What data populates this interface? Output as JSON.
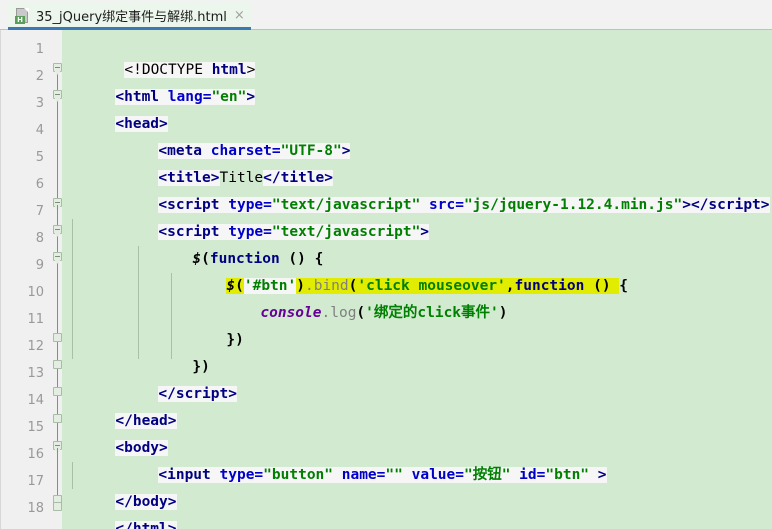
{
  "window": {
    "app": "IntelliJ IDEA HTML Editor"
  },
  "tab": {
    "title": "35_jQuery绑定事件与解绑.html",
    "icon": "html-file-icon",
    "badge": "H",
    "close": "×"
  },
  "editor": {
    "background_color": "#d2ead0",
    "text_background_color": "#f6f6f6",
    "highlight_color": "#e2ec00",
    "gutter_color": "#f0f0f0",
    "line_count": 18,
    "line_numbers": [
      "1",
      "2",
      "3",
      "4",
      "5",
      "6",
      "7",
      "8",
      "9",
      "10",
      "11",
      "12",
      "13",
      "14",
      "15",
      "16",
      "17",
      "18"
    ],
    "lines": [
      {
        "n": "1",
        "text": "<!DOCTYPE html>"
      },
      {
        "n": "2",
        "text": "<html lang=\"en\">"
      },
      {
        "n": "3",
        "text": "<head>"
      },
      {
        "n": "4",
        "text": "    <meta charset=\"UTF-8\">"
      },
      {
        "n": "5",
        "text": "    <title>Title</title>"
      },
      {
        "n": "6",
        "text": "    <script type=\"text/javascript\" src=\"js/jquery-1.12.4.min.js\"></script>"
      },
      {
        "n": "7",
        "text": "    <script type=\"text/javascript\">"
      },
      {
        "n": "8",
        "text": "        $(function () {"
      },
      {
        "n": "9",
        "text": "            $('#btn').bind('click mouseover',function () {"
      },
      {
        "n": "10",
        "text": "                console.log('绑定的click事件')"
      },
      {
        "n": "11",
        "text": "            })"
      },
      {
        "n": "12",
        "text": "        })"
      },
      {
        "n": "13",
        "text": "    </script>"
      },
      {
        "n": "14",
        "text": "</head>"
      },
      {
        "n": "15",
        "text": "<body>"
      },
      {
        "n": "16",
        "text": "    <input type=\"button\" name=\"\" value=\"按钮\" id=\"btn\" >"
      },
      {
        "n": "17",
        "text": "</body>"
      },
      {
        "n": "18",
        "text": "</html>"
      }
    ],
    "tokens": {
      "doctype": "<!DOCTYPE ",
      "doctype_name": "html",
      "gt": ">",
      "lt_html": "<html",
      "lang_attr": " lang=",
      "lang_val": "\"en\"",
      "lt_head": "<head",
      "lt_meta": "<meta",
      "charset_attr": " charset=",
      "charset_val": "\"UTF-8\"",
      "lt_title": "<title",
      "title_text": "Title",
      "close_title": "</title",
      "lt_script": "<script",
      "type_attr": " type=",
      "type_val": "\"text/javascript\"",
      "src_attr": " src=",
      "src_val": "\"js/jquery-1.12.4.min.js\"",
      "close_script_tag": "</script",
      "dollar": "$",
      "paren_open": "(",
      "kw_function": "function",
      "empty_parens": " () ",
      "brace_open": "{",
      "btn_selector": "'#btn'",
      "paren_close": ")",
      "dot_bind": ".bind",
      "bind_args": "'click mouseover'",
      "comma": ",",
      "console_ident": "console",
      "dot_log": ".log",
      "log_arg": "'绑定的click事件'",
      "brace_close_paren": "})",
      "close_head": "</head",
      "lt_body": "<body",
      "lt_input": "<input",
      "input_type_val": "\"button\"",
      "name_attr": " name=",
      "name_val": "\"\"",
      "value_attr": " value=",
      "value_val": "\"按钮\"",
      "id_attr": " id=",
      "id_val": "\"btn\"",
      "input_end": " >",
      "close_body": "</body",
      "close_html": "</html"
    }
  }
}
